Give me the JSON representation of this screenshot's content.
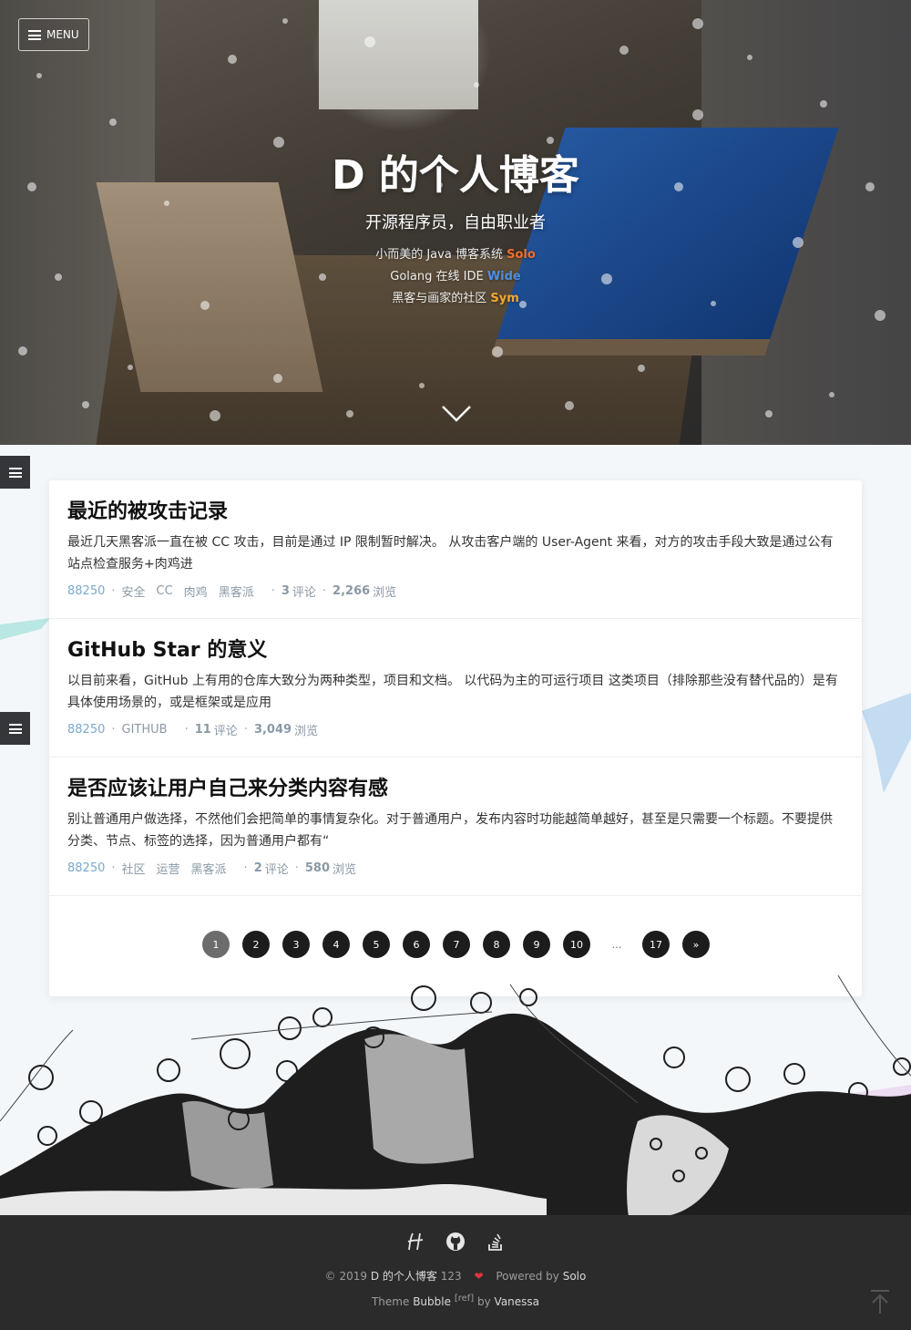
{
  "header": {
    "menu_label": "MENU",
    "title": "D 的个人博客",
    "subtitle": "开源程序员，自由职业者",
    "lines": [
      {
        "text": "小而美的 Java 博客系统 ",
        "link": "Solo",
        "color": "#f06d2a"
      },
      {
        "text": "Golang 在线 IDE ",
        "link": "Wide",
        "color": "#4a90e2"
      },
      {
        "text": "黑客与画家的社区 ",
        "link": "Sym",
        "color": "#f3a833"
      }
    ]
  },
  "articles": [
    {
      "title": "最近的被攻击记录",
      "summary": "最近几天黑客派一直在被 CC 攻击，目前是通过 IP 限制暂时解决。 从攻击客户端的 User-Agent 来看，对方的攻击手段大致是通过公有站点检查服务+肉鸡进",
      "author": "88250",
      "tags": [
        "安全",
        "CC",
        "肉鸡",
        "黑客派"
      ],
      "comments": "3",
      "comments_label": "评论",
      "views": "2,266",
      "views_label": "浏览"
    },
    {
      "title": "GitHub Star 的意义",
      "summary": "以目前来看，GitHub 上有用的仓库大致分为两种类型，项目和文档。 以代码为主的可运行项目 这类项目（排除那些没有替代品的）是有具体使用场景的，或是框架或是应用",
      "author": "88250",
      "tags": [
        "GITHUB"
      ],
      "comments": "11",
      "comments_label": "评论",
      "views": "3,049",
      "views_label": "浏览"
    },
    {
      "title": "是否应该让用户自己来分类内容有感",
      "summary": "别让普通用户做选择，不然他们会把简单的事情复杂化。对于普通用户，发布内容时功能越简单越好，甚至是只需要一个标题。不要提供分类、节点、标签的选择，因为普通用户都有“",
      "author": "88250",
      "tags": [
        "社区",
        "运营",
        "黑客派"
      ],
      "comments": "2",
      "comments_label": "评论",
      "views": "580",
      "views_label": "浏览"
    }
  ],
  "pagination": {
    "current": "1",
    "pages": [
      "1",
      "2",
      "3",
      "4",
      "5",
      "6",
      "7",
      "8",
      "9",
      "10",
      "…",
      "17",
      "»"
    ]
  },
  "footer": {
    "icons": [
      "hacpai-icon",
      "github-icon",
      "stackoverflow-icon"
    ],
    "copyright": "© 2019 ",
    "site_name": "D 的个人博客",
    "site_suffix": " 123",
    "powered_prefix": "Powered by ",
    "powered_link": "Solo",
    "theme_prefix": "Theme ",
    "theme_name": "Bubble",
    "theme_ref": "[ref]",
    "theme_by": " by ",
    "theme_author": "Vanessa"
  }
}
